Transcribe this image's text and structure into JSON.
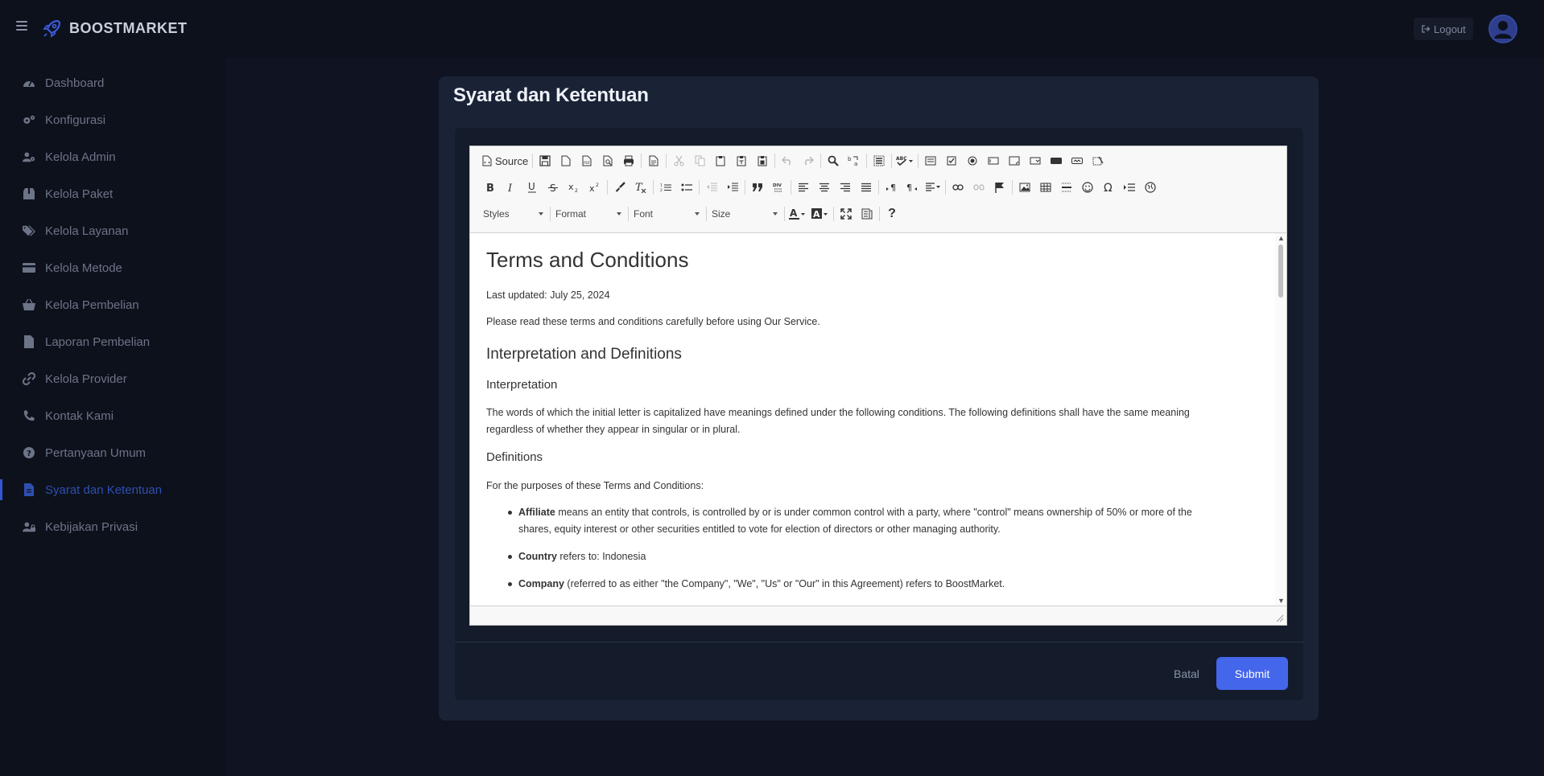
{
  "app": {
    "brand": "BOOSTMARKET",
    "logout_label": "Logout"
  },
  "sidebar": {
    "items": [
      {
        "label": "Dashboard",
        "icon": "gauge-icon"
      },
      {
        "label": "Konfigurasi",
        "icon": "gears-icon"
      },
      {
        "label": "Kelola Admin",
        "icon": "user-gear-icon"
      },
      {
        "label": "Kelola Paket",
        "icon": "box-icon"
      },
      {
        "label": "Kelola Layanan",
        "icon": "tags-icon"
      },
      {
        "label": "Kelola Metode",
        "icon": "credit-card-icon"
      },
      {
        "label": "Kelola Pembelian",
        "icon": "basket-icon"
      },
      {
        "label": "Laporan Pembelian",
        "icon": "file-icon"
      },
      {
        "label": "Kelola Provider",
        "icon": "link-icon"
      },
      {
        "label": "Kontak Kami",
        "icon": "phone-icon"
      },
      {
        "label": "Pertanyaan Umum",
        "icon": "question-icon"
      },
      {
        "label": "Syarat dan Ketentuan",
        "icon": "file-text-icon",
        "active": true
      },
      {
        "label": "Kebijakan Privasi",
        "icon": "user-lock-icon"
      }
    ]
  },
  "modal": {
    "title": "Syarat dan Ketentuan",
    "cancel_label": "Batal",
    "submit_label": "Submit"
  },
  "editor": {
    "toolbar": {
      "source_label": "Source",
      "styles_label": "Styles",
      "format_label": "Format",
      "font_label": "Font",
      "size_label": "Size",
      "help_label": "?"
    },
    "content": {
      "h1": "Terms and Conditions",
      "updated": "Last updated: July 25, 2024",
      "intro": "Please read these terms and conditions carefully before using Our Service.",
      "h2_interp": "Interpretation and Definitions",
      "h3_interp": "Interpretation",
      "interp_p1": "The words of which the initial letter is capitalized have meanings defined under the following conditions. The following definitions shall have the same meaning",
      "interp_p2": "regardless of whether they appear in singular or in plural.",
      "h3_defs": "Definitions",
      "defs_intro": "For the purposes of these Terms and Conditions:",
      "items": [
        {
          "term": "Affiliate",
          "text_line1": " means an entity that controls, is controlled by or is under common control with a party, where \"control\" means ownership of 50% or more of the",
          "text_line2": "shares, equity interest or other securities entitled to vote for election of directors or other managing authority."
        },
        {
          "term": "Country",
          "text_line1": " refers to: Indonesia"
        },
        {
          "term": "Company",
          "text_line1": " (referred to as either \"the Company\", \"We\", \"Us\" or \"Our\" in this Agreement) refers to BoostMarket."
        }
      ]
    }
  },
  "colors": {
    "accent": "#4466ea",
    "active_nav": "#2f4fb0",
    "modal_bg": "#1a2336"
  }
}
